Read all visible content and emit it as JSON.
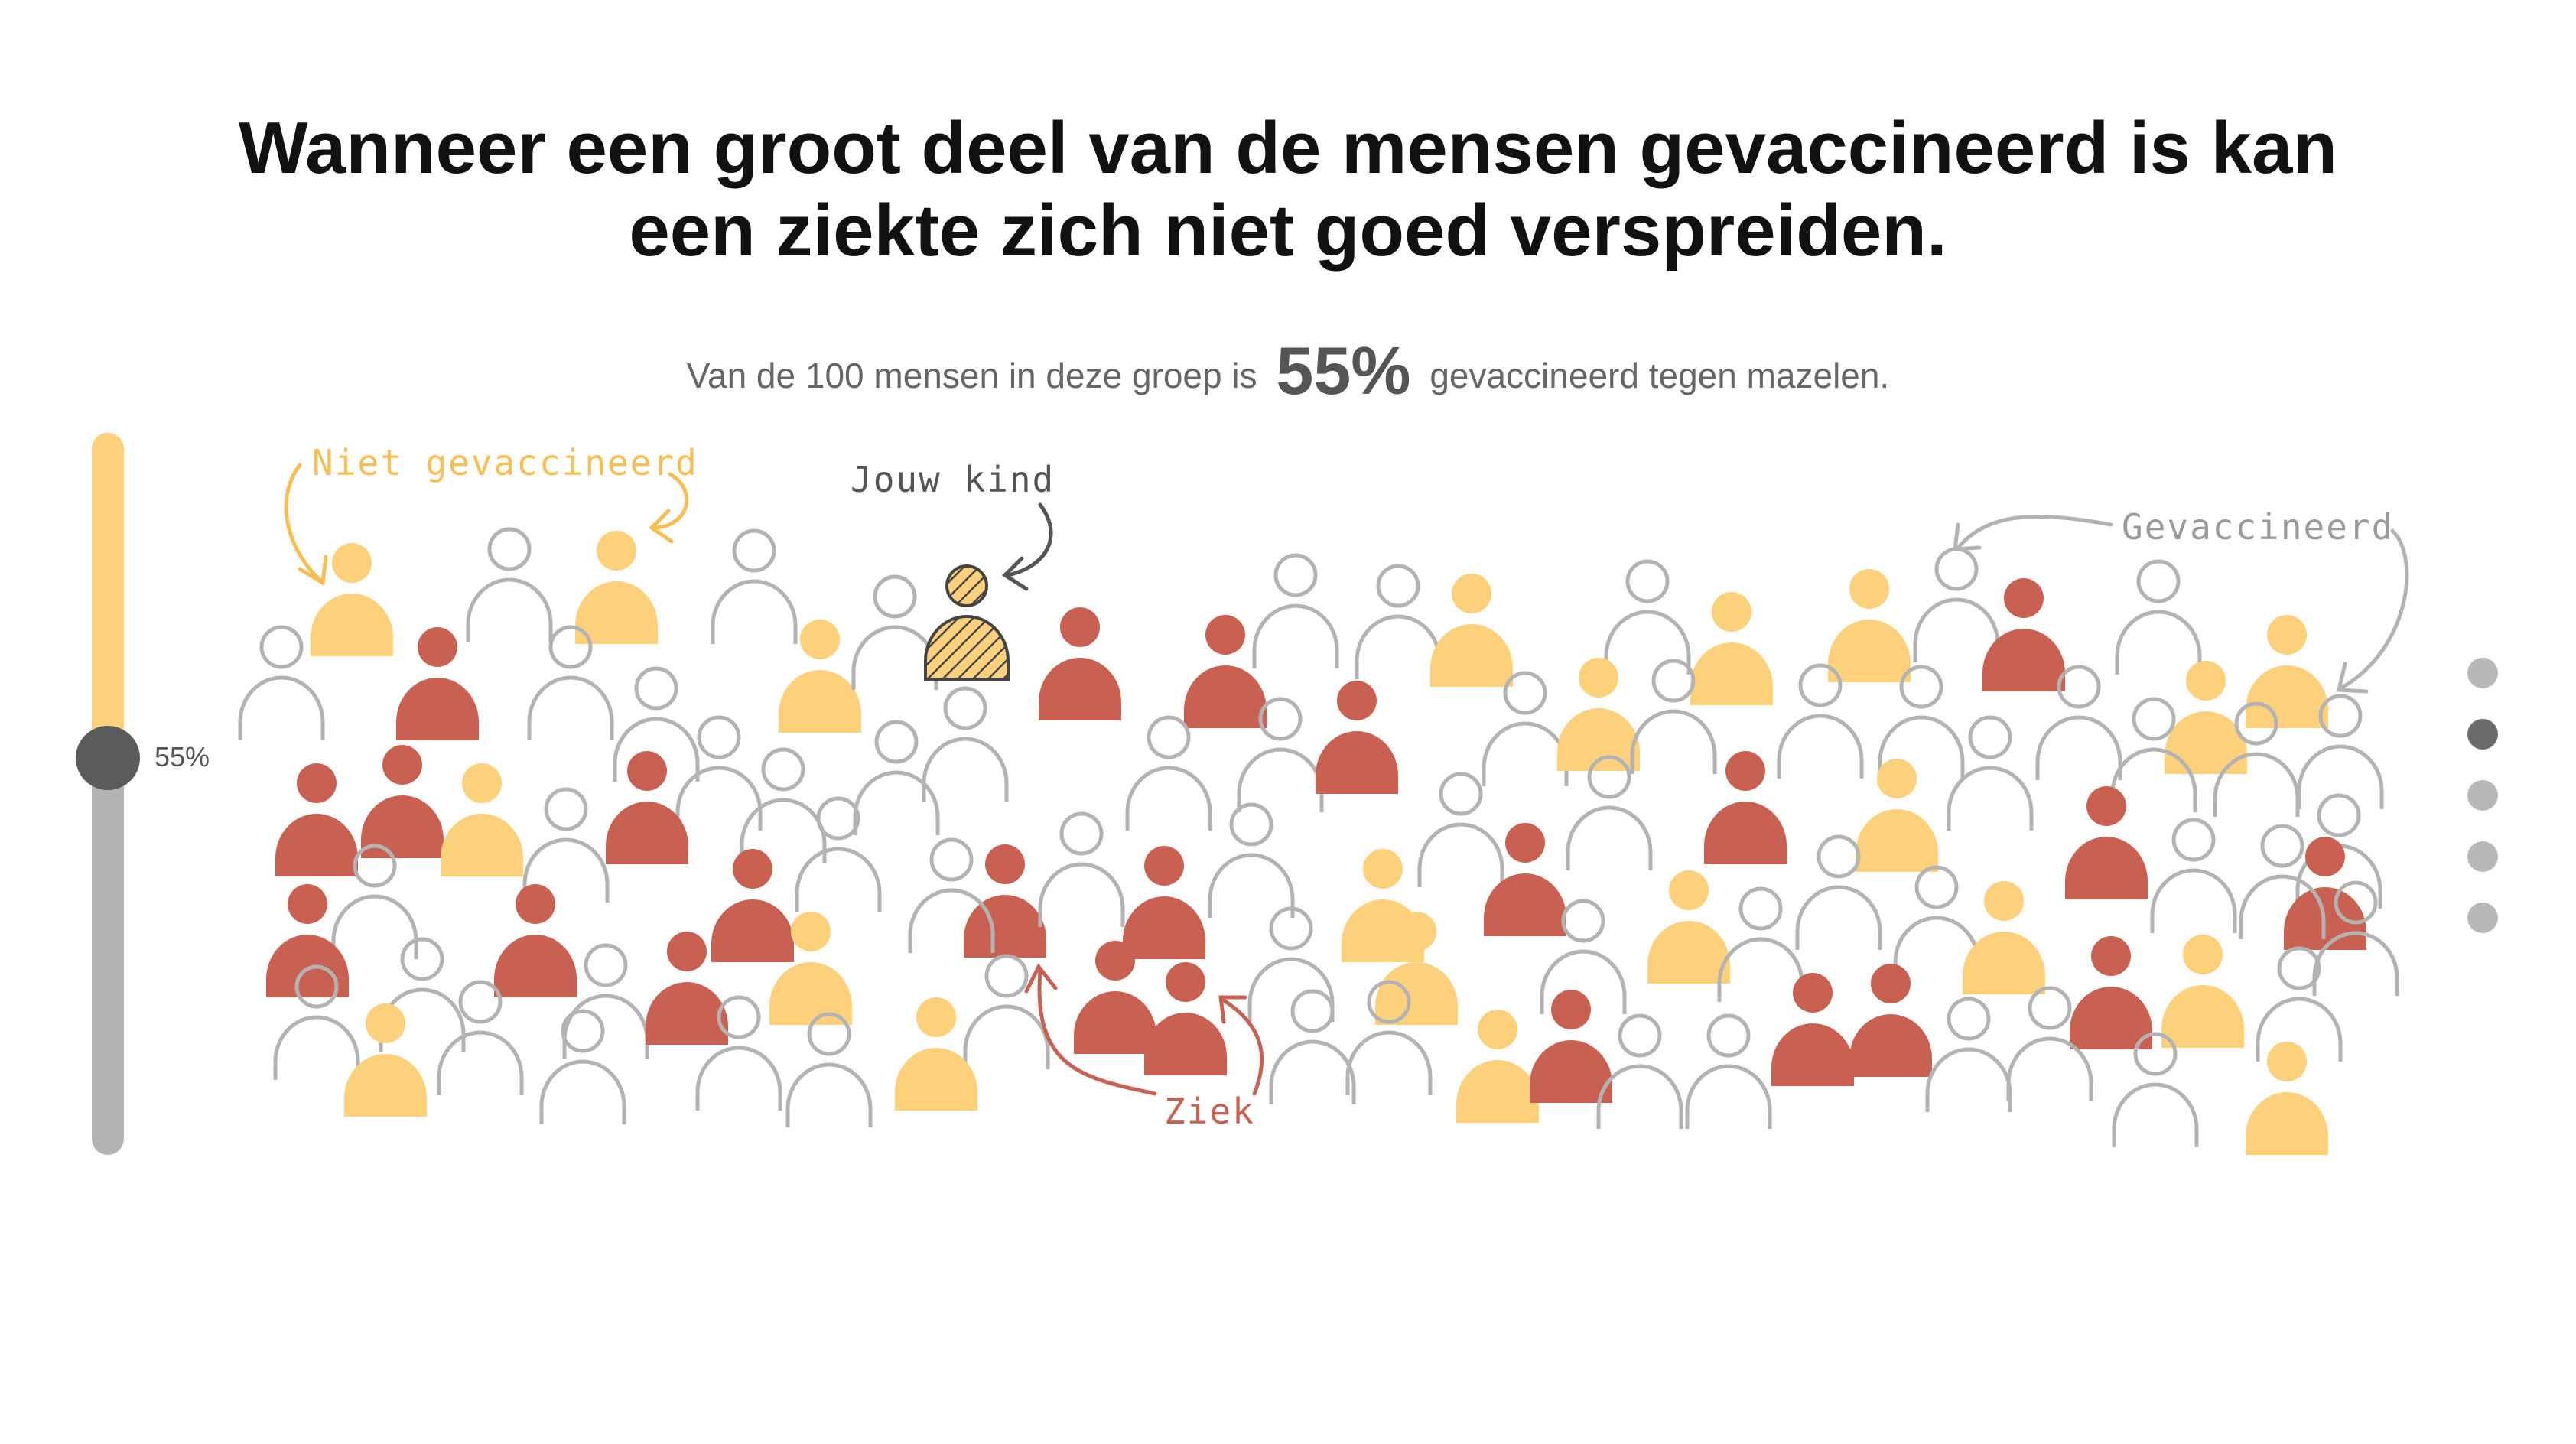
{
  "header": {
    "title_line1": "Wanneer een groot deel van de mensen gevaccineerd is kan",
    "title_line2": "een ziekte zich niet goed verspreiden."
  },
  "subtitle": {
    "prefix": "Van de 100 mensen in deze groep is",
    "percentage": "55%",
    "suffix": "gevaccineerd tegen mazelen."
  },
  "slider": {
    "value_label": "55%",
    "value_percent": 55
  },
  "annotations": {
    "not_vaccinated": "Niet gevaccineerd",
    "your_child": "Jouw kind",
    "vaccinated": "Gevaccineerd",
    "sick": "Ziek"
  },
  "legend_colors": {
    "vaccinated": "#b3b3b3",
    "not_vaccinated": "#fdd07c",
    "sick": "#c96152",
    "your_child": "#fdd07c"
  },
  "pagination": {
    "dot_count": 5,
    "active_index": 1
  },
  "icons": {
    "person": "person-icon",
    "child": "hatched-person-icon",
    "arrow": "curved-arrow-icon"
  }
}
